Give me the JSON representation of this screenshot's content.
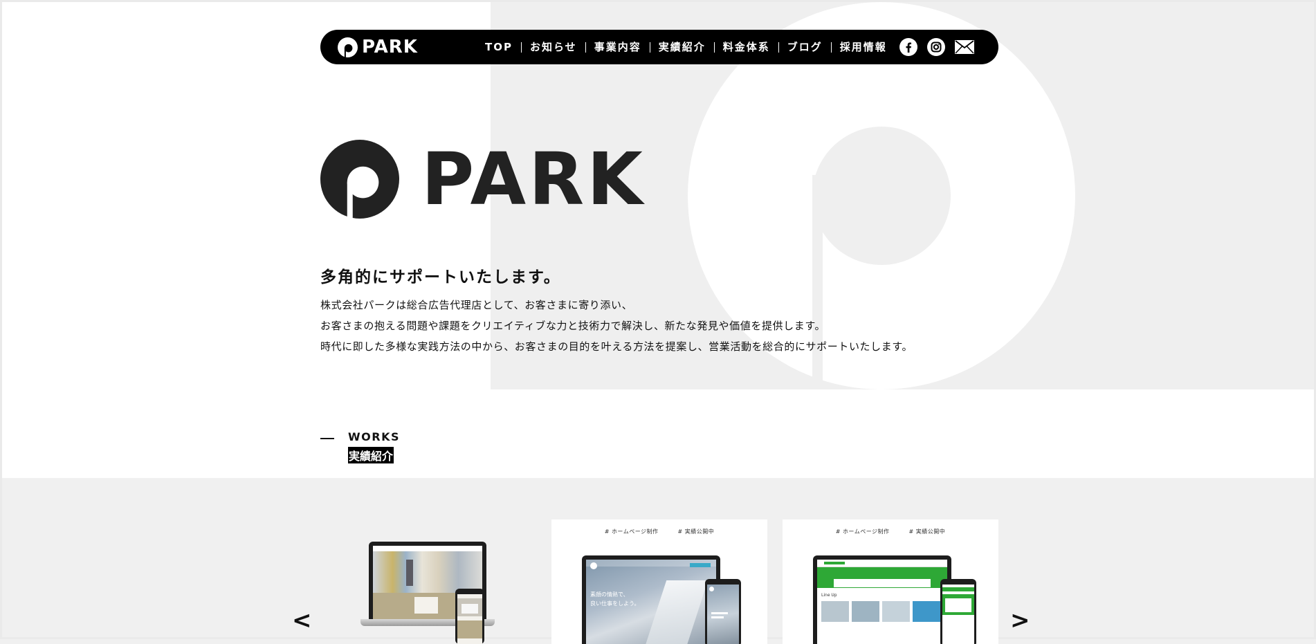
{
  "brand": {
    "name": "PARK"
  },
  "nav": {
    "items": [
      {
        "label": "TOP"
      },
      {
        "label": "お知らせ"
      },
      {
        "label": "事業内容"
      },
      {
        "label": "実績紹介"
      },
      {
        "label": "料金体系"
      },
      {
        "label": "ブログ"
      },
      {
        "label": "採用情報"
      }
    ],
    "social_icons": [
      "facebook-icon",
      "instagram-icon",
      "mail-icon"
    ]
  },
  "hero": {
    "logo_text": "PARK",
    "tagline": "多角的にサポートいたします。",
    "description": [
      "株式会社パークは総合広告代理店として、お客さまに寄り添い、",
      "お客さまの抱える問題や課題をクリエイティブな力と技術力で解決し、新たな発見や価値を提供します。",
      "時代に即した多様な実践方法の中から、お客さまの目的を叶える方法を提案し、営業活動を総合的にサポートいたします。"
    ]
  },
  "works": {
    "heading_en": "WORKS",
    "heading_ja": "実績紹介",
    "prev_label": "<",
    "next_label": ">",
    "cards": [
      {
        "tags": []
      },
      {
        "tags": [
          "ホームページ制作",
          "実績公開中"
        ],
        "screen_text": [
          "素顔の情熱で、",
          "良い仕事をしよう。"
        ]
      },
      {
        "tags": [
          "ホームページ制作",
          "実績公開中"
        ],
        "screen_text": [
          "Line Up"
        ]
      }
    ]
  },
  "colors": {
    "nav_bg": "#000000",
    "accent_green": "#2ea836",
    "hero_gray": "#efefef",
    "text": "#111111"
  }
}
